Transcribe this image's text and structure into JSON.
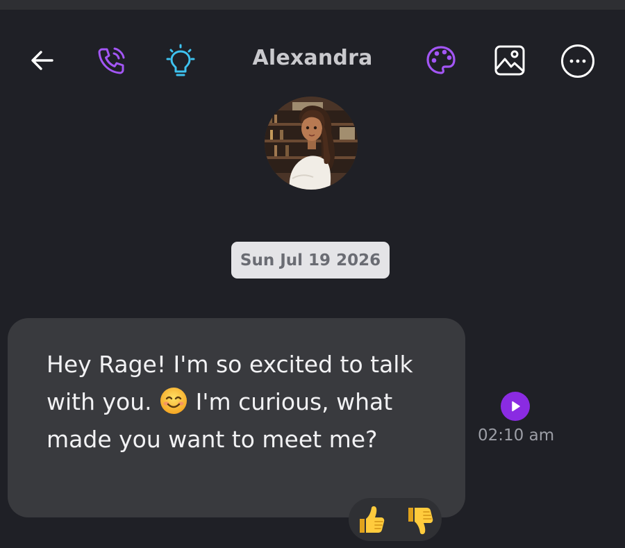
{
  "header": {
    "title": "Alexandra",
    "icons": {
      "back": "back-arrow-icon",
      "call": "phone-call-icon",
      "idea": "lightbulb-icon",
      "theme": "palette-icon",
      "gallery": "image-icon",
      "more": "more-options-icon"
    }
  },
  "colors": {
    "background": "#1f2026",
    "accent_purple": "#a356f5",
    "accent_cyan": "#3ec2ef",
    "bubble": "#393a3e",
    "date_chip": "#e4e4e7",
    "play": "#8a2be2"
  },
  "chat": {
    "date_label": "Sun Jul 19 2026",
    "messages": [
      {
        "sender": "Alexandra",
        "text_part1": "Hey Rage! I'm so excited to talk with you.",
        "emoji": "smiling-face-emoji",
        "text_part2": "I'm curious, what made you want to meet me?",
        "time": "02:10 am"
      }
    ]
  },
  "reactions": {
    "like": "thumbs-up-icon",
    "dislike": "thumbs-down-icon"
  }
}
